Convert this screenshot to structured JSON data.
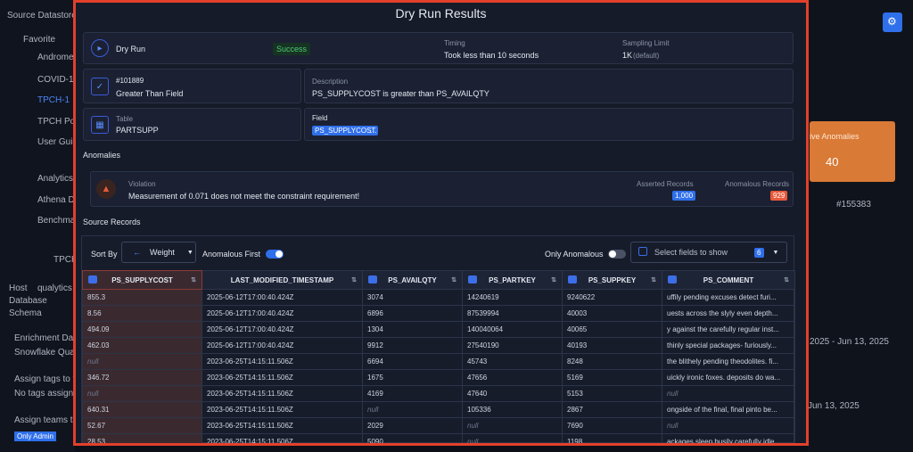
{
  "background": {
    "left": [
      "Source Datastores",
      "Favorite",
      "Andromed",
      "COVID-19",
      "TPCH-1",
      "TPCH Pos",
      "User Guid",
      "Analytics",
      "Athena DS",
      "Benchmar",
      "TPCH",
      "Host",
      "qualytics",
      "Database",
      "Schema",
      "Enrichment Data",
      "Snowflake Qualy",
      "Assign tags to th",
      "No tags assigned",
      "Assign teams to",
      "Only Admin"
    ],
    "right": [
      "ive Anomalies",
      "40",
      "#155383",
      "2025 - Jun 13, 2025",
      "Jun 13, 2025"
    ]
  },
  "modal": {
    "title": "Dry Run Results",
    "dry_run": {
      "label": "Dry Run",
      "status": "Success",
      "timing_label": "Timing",
      "timing_value": "Took less than 10 seconds",
      "sampling_label": "Sampling Limit",
      "sampling_value": "1K",
      "sampling_note": "(default)"
    },
    "check": {
      "id": "#101889",
      "rule": "Greater Than Field",
      "desc_label": "Description",
      "desc_value": "PS_SUPPLYCOST is greater than PS_AVAILQTY"
    },
    "table": {
      "label": "Table",
      "value": "PARTSUPP",
      "field_label": "Field",
      "field_chip": "PS_SUPPLYCOST",
      "field_more": "..."
    },
    "anomalies": {
      "heading": "Anomalies",
      "violation_label": "Violation",
      "violation_text": "Measurement of 0.071 does not meet the constraint requirement!",
      "asserted_label": "Asserted Records",
      "asserted_value": "1,000",
      "anomalous_label": "Anomalous Records",
      "anomalous_value": "929"
    },
    "source": {
      "heading": "Source Records",
      "sort_by": "Sort By",
      "sort_value": "Weight",
      "anomalous_first": "Anomalous First",
      "only_anomalous": "Only Anomalous",
      "select_fields": "Select fields to show",
      "field_count": "6"
    },
    "columns": [
      "PS_SUPPLYCOST",
      "LAST_MODIFIED_TIMESTAMP",
      "PS_AVAILQTY",
      "PS_PARTKEY",
      "PS_SUPPKEY",
      "PS_COMMENT"
    ],
    "rows": [
      [
        "855.3",
        "2025-06-12T17:00:40.424Z",
        "3074",
        "14240619",
        "9240622",
        "uffily pending excuses detect furi..."
      ],
      [
        "8.56",
        "2025-06-12T17:00:40.424Z",
        "6896",
        "87539994",
        "40003",
        "uests across the slyly even depth..."
      ],
      [
        "494.09",
        "2025-06-12T17:00:40.424Z",
        "1304",
        "140040064",
        "40065",
        "y against the carefully regular inst..."
      ],
      [
        "462.03",
        "2025-06-12T17:00:40.424Z",
        "9912",
        "27540190",
        "40193",
        "thinly special packages- furiously..."
      ],
      [
        "null",
        "2023-06-25T14:15:11.506Z",
        "6694",
        "45743",
        "8248",
        "the blithely pending theodolites. fi..."
      ],
      [
        "346.72",
        "2023-06-25T14:15:11.506Z",
        "1675",
        "47656",
        "5169",
        "uickly ironic foxes. deposits do wa..."
      ],
      [
        "null",
        "2023-06-25T14:15:11.506Z",
        "4169",
        "47640",
        "5153",
        "null"
      ],
      [
        "640.31",
        "2023-06-25T14:15:11.506Z",
        "null",
        "105336",
        "2867",
        "ongside of the final, final pinto be..."
      ],
      [
        "52.67",
        "2023-06-25T14:15:11.506Z",
        "2029",
        "null",
        "7690",
        "null"
      ],
      [
        "28.53",
        "2023-06-25T14:15:11.506Z",
        "5090",
        "null",
        "1198",
        "ackages sleep busily carefully idle..."
      ]
    ]
  },
  "colors": {
    "accent": "#2f6fea",
    "danger": "#e85a3a",
    "success": "#4cc774",
    "modal_border": "#e2402b"
  }
}
